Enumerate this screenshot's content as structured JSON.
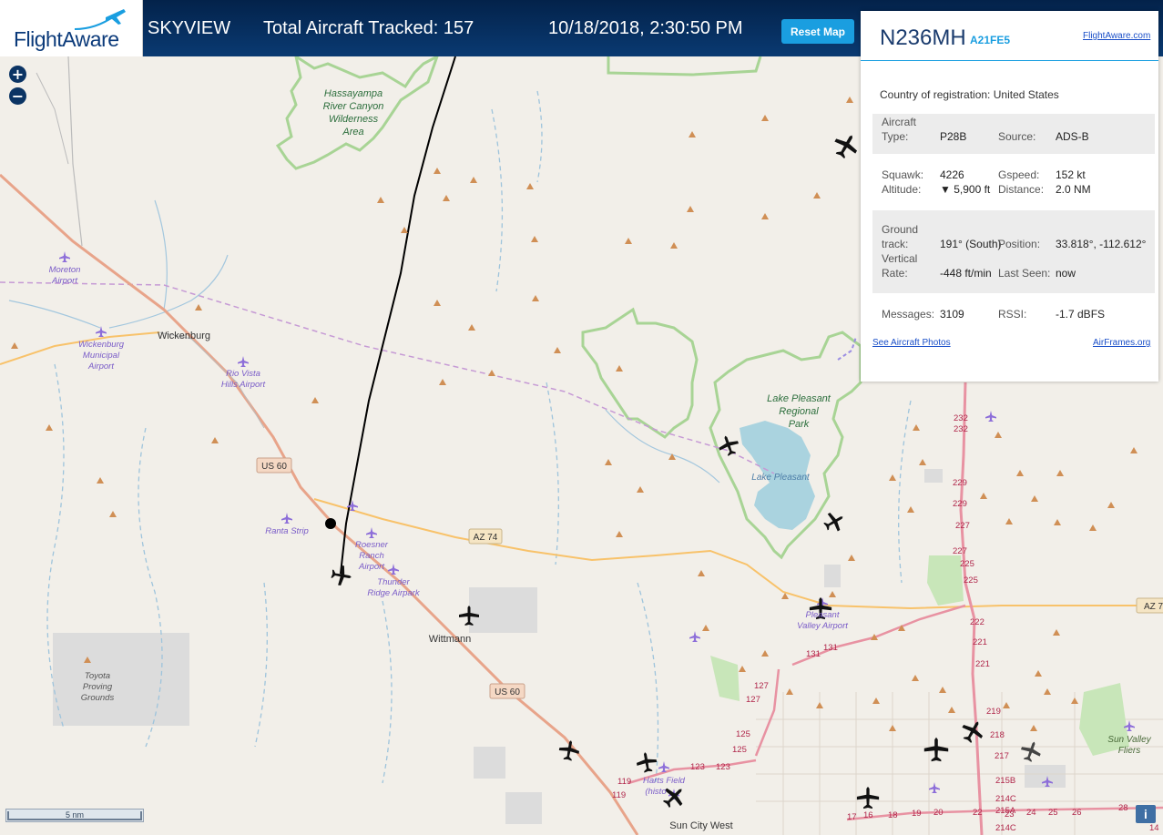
{
  "header": {
    "logo_text": "FlightAware",
    "title": "SKYVIEW",
    "total_tracked": "Total Aircraft Tracked: 157",
    "datetime": "10/18/2018, 2:30:50 PM",
    "reset_label": "Reset Map"
  },
  "map_controls": {
    "zoom_in": "+",
    "zoom_out": "−",
    "scale_label": "5 nm",
    "info": "i"
  },
  "map_labels": {
    "hassayampa": [
      "Hassayampa",
      "River Canyon",
      "Wilderness",
      "Area"
    ],
    "lake_pleasant_park": [
      "Lake Pleasant",
      "Regional",
      "Park"
    ],
    "lake_pleasant": "Lake Pleasant",
    "moreton": [
      "Moreton",
      "Airport"
    ],
    "wickenburg": "Wickenburg",
    "wickenburg_airport": [
      "Wickenburg",
      "Municipal",
      "Airport"
    ],
    "rio_vista": [
      "Rio Vista",
      "Hills Airport"
    ],
    "ranta": "Ranta Strip",
    "roesner": [
      "Roesner",
      "Ranch",
      "Airport"
    ],
    "thunder": [
      "Thunder",
      "Ridge Airpark"
    ],
    "wittmann": "Wittmann",
    "toyota": [
      "Toyota",
      "Proving",
      "Grounds"
    ],
    "pleasant_valley": [
      "Pleasant",
      "Valley Airport"
    ],
    "harts": [
      "Harts Field",
      "(histo"
    ],
    "sun_city_west": "Sun City West",
    "sun_valley": [
      "Sun Valley",
      "Fliers"
    ],
    "us60_a": "US 60",
    "us60_b": "US 60",
    "az74_a": "AZ 74",
    "az74_b": "AZ 7",
    "road_numbers": [
      "232",
      "232",
      "229",
      "229",
      "227",
      "227",
      "225",
      "225",
      "222",
      "221",
      "221",
      "219",
      "218",
      "217",
      "215B",
      "214C",
      "215A",
      "214C",
      "24",
      "25",
      "26",
      "28",
      "14",
      "131",
      "131",
      "127",
      "127",
      "125",
      "125",
      "123",
      "123",
      "119",
      "119",
      "16",
      "17",
      "18",
      "19",
      "20",
      "22",
      "23"
    ]
  },
  "panel": {
    "registration": "N236MH",
    "hex": "A21FE5",
    "fa_link": "FlightAware.com",
    "country_label": "Country of registration:",
    "country_value": "United States",
    "aircraft_label_1": "Aircraft",
    "type_label": "Type:",
    "type_value": "P28B",
    "source_label": "Source:",
    "source_value": "ADS-B",
    "squawk_label": "Squawk:",
    "squawk_value": "4226",
    "gspeed_label": "Gspeed:",
    "gspeed_value": "152 kt",
    "altitude_label": "Altitude:",
    "altitude_value": "▼ 5,900 ft",
    "distance_label": "Distance:",
    "distance_value": "2.0 NM",
    "ground_label_1": "Ground",
    "ground_label_2": "track:",
    "track_value": "191° (South)",
    "position_label": "Position:",
    "position_value": "33.818°, -112.612°",
    "vertical_label_1": "Vertical",
    "vertical_label_2": "Rate:",
    "vrate_value": "-448 ft/min",
    "lastseen_label": "Last Seen:",
    "lastseen_value": "now",
    "messages_label": "Messages:",
    "messages_value": "3109",
    "rssi_label": "RSSI:",
    "rssi_value": "-1.7 dBFS",
    "photos_link": "See Aircraft Photos",
    "airframes_link": "AirFrames.org"
  },
  "colors": {
    "header": "#0a3a72",
    "accent": "#1a9ee0",
    "map_bg": "#f2efe9",
    "park_border": "#a8d495",
    "water": "#aad3df",
    "motorway": "#e892a2",
    "highway": "#f8c26a",
    "track": "#000000",
    "airport": "#8d6ed9",
    "peak": "#d08f55"
  }
}
